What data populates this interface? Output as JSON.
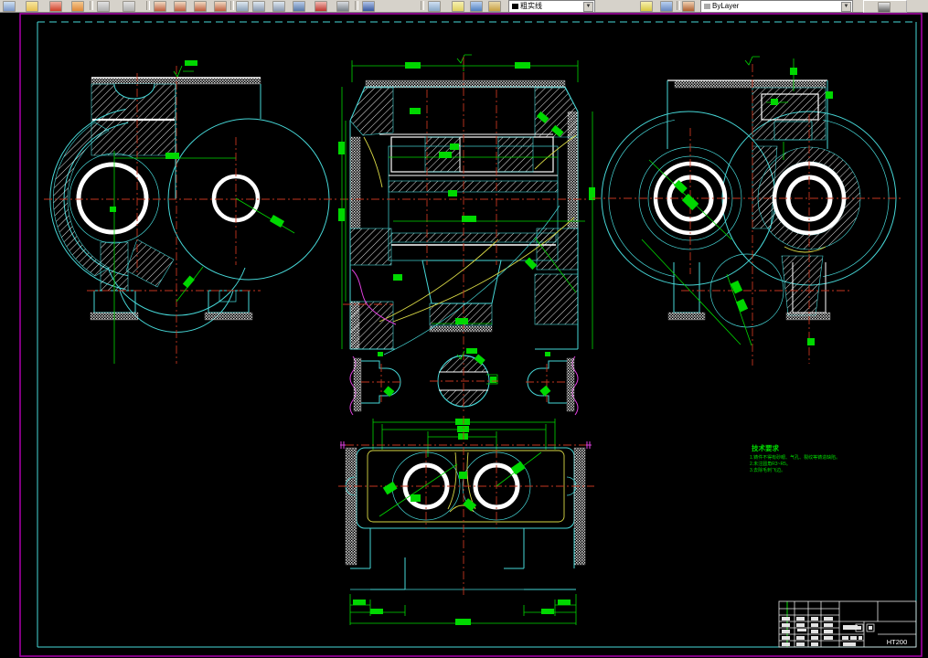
{
  "toolbar": {
    "layer_value": "粗实线",
    "style_value": "ByLayer"
  },
  "tech_requirements": {
    "title": "技术要求",
    "line1": "1.铸件不得有砂眼、气孔、裂纹等铸造缺陷。",
    "line2": "2.未注圆角R3~R5。",
    "line3": "3.去除毛刺飞边。"
  },
  "title_block": {
    "material": "HT200"
  }
}
